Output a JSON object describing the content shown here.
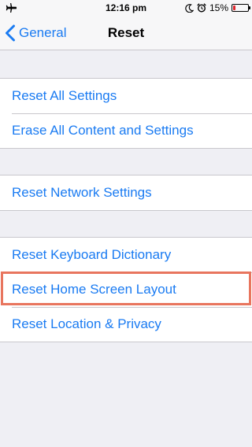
{
  "status_bar": {
    "time": "12:16 pm",
    "battery_percent": "15%",
    "battery_level": 0.15,
    "battery_color": "#e0242b",
    "icons": [
      "airplane-icon",
      "moon-icon",
      "alarm-clock-icon",
      "battery-icon"
    ]
  },
  "nav": {
    "back_label": "General",
    "title": "Reset",
    "tint": "#1a7bf2"
  },
  "groups": [
    {
      "items": [
        {
          "label": "Reset All Settings"
        },
        {
          "label": "Erase All Content and Settings"
        }
      ]
    },
    {
      "items": [
        {
          "label": "Reset Network Settings"
        }
      ]
    },
    {
      "items": [
        {
          "label": "Reset Keyboard Dictionary"
        },
        {
          "label": "Reset Home Screen Layout",
          "highlighted": true,
          "highlight_color": "#e8755e"
        },
        {
          "label": "Reset Location & Privacy"
        }
      ]
    }
  ]
}
